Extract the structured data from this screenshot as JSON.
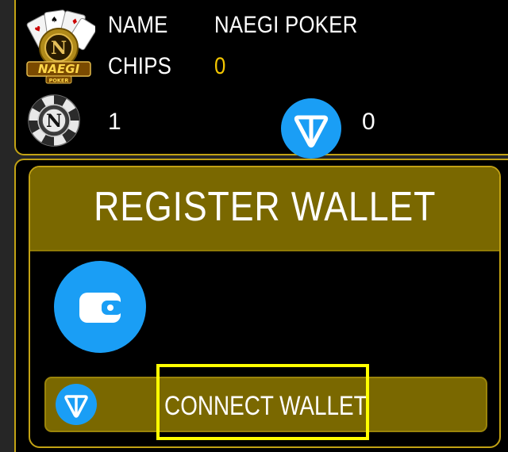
{
  "profile": {
    "name_label": "NAME",
    "name_value": "NAEGI POKER",
    "chips_label": "CHIPS",
    "chips_value": "0",
    "logo_text": "NAEGI",
    "logo_subtext": "POKER",
    "logo_monogram": "N",
    "chip_token_count": "1",
    "ton_count": "0"
  },
  "register": {
    "title": "REGISTER WALLET",
    "connect_label": "CONNECT WALLET"
  },
  "colors": {
    "accent_gold": "#c2a214",
    "panel_olive": "#7a6800",
    "chips_value_yellow": "#f2c500",
    "ton_blue": "#1a9ef5",
    "highlight_yellow": "#ffff00"
  },
  "icons": {
    "logo": "naegi-poker-logo",
    "chip": "poker-chip-icon",
    "ton": "ton-icon",
    "wallet": "wallet-icon"
  }
}
